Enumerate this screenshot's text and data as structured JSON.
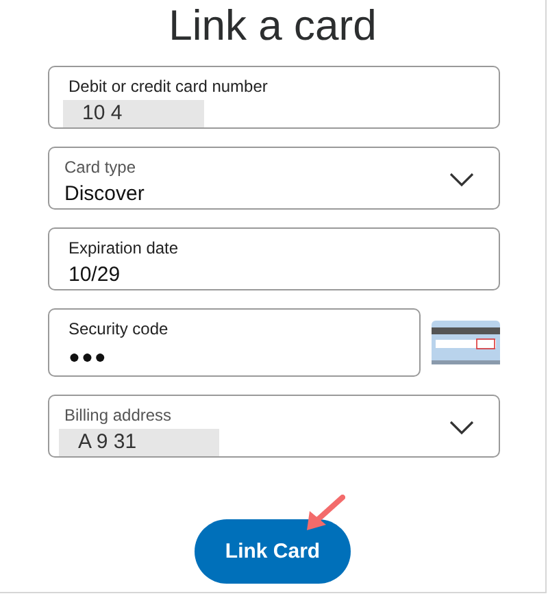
{
  "title": "Link a card",
  "fields": [
    {
      "kind": "text",
      "label": "Debit or credit card number",
      "value": "10  4",
      "redacted": true
    },
    {
      "kind": "select",
      "label": "Card type",
      "value": "Discover",
      "redacted": false
    },
    {
      "kind": "text",
      "label": "Expiration date",
      "value": "10/29",
      "redacted": false
    },
    {
      "kind": "secure",
      "label": "Security code",
      "value": "●●●",
      "redacted": false
    },
    {
      "kind": "select",
      "label": "Billing address",
      "value": "A 9  31",
      "redacted": true
    }
  ],
  "button": "Link Card"
}
